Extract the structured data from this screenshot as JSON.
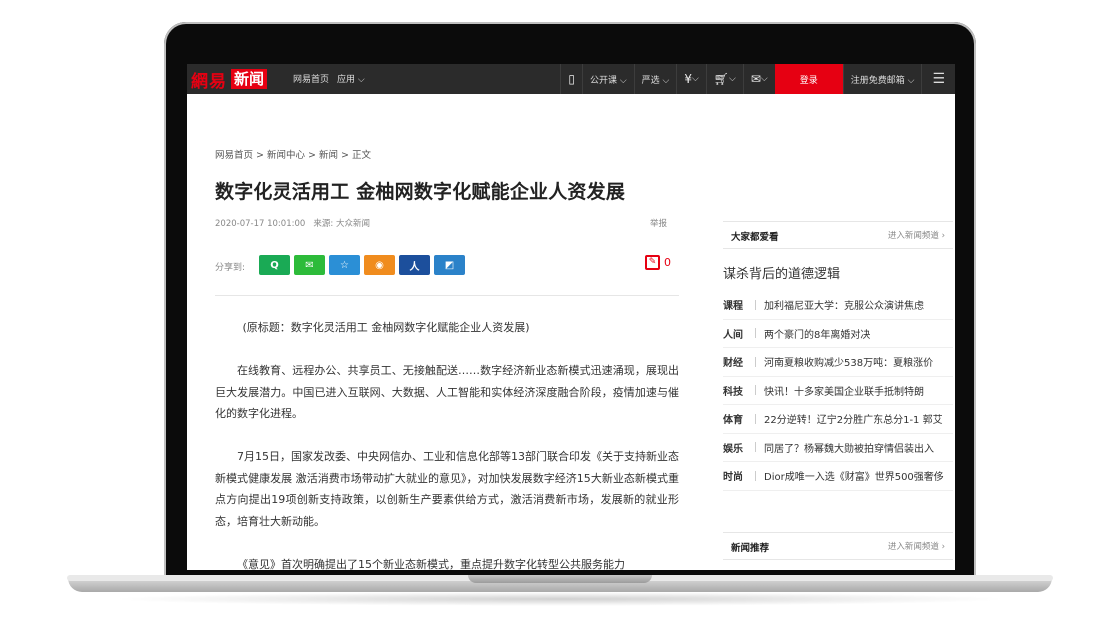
{
  "topnav": {
    "logo_163": "網易",
    "logo_news": "新闻",
    "left_links": [
      "网易首页",
      "应用 ⌵"
    ],
    "right_items": [
      {
        "label": "",
        "icon": "mobile-app-icon"
      },
      {
        "label": "公开课 ⌵",
        "icon": ""
      },
      {
        "label": "严选 ⌵",
        "icon": ""
      },
      {
        "label": "⌵",
        "icon": "yuan-icon"
      },
      {
        "label": "⌵",
        "icon": "cart-icon"
      },
      {
        "label": "⌵",
        "icon": "mail-icon"
      }
    ],
    "login": "登录",
    "register": "注册免费邮箱 ⌵",
    "menu": "☰"
  },
  "article": {
    "breadcrumb": "网易首页 > 新闻中心 > 新闻 > 正文",
    "title": "数字化灵活用工 金柚网数字化赋能企业人资发展",
    "time": "2020-07-17 10:01:00",
    "source": "来源: 大众新闻",
    "report": "举报",
    "share_label": "分享到:",
    "share_buttons": [
      {
        "name": "qq-icon",
        "glyph": "Q",
        "color": "#1aaa55"
      },
      {
        "name": "wechat-icon",
        "glyph": "✉",
        "color": "#2dbb3a"
      },
      {
        "name": "qzone-icon",
        "glyph": "☆",
        "color": "#2b8fd6"
      },
      {
        "name": "weibo-icon",
        "glyph": "◉",
        "color": "#f08c1e"
      },
      {
        "name": "renren-icon",
        "glyph": "人",
        "color": "#1c4f9c"
      },
      {
        "name": "yixin-icon",
        "glyph": "◩",
        "color": "#2b82c9"
      }
    ],
    "comment_count": "0",
    "paragraphs": [
      "(原标题：数字化灵活用工 金柚网数字化赋能企业人资发展)",
      "在线教育、远程办公、共享员工、无接触配送……数字经济新业态新模式迅速涌现，展现出巨大发展潜力。中国已进入互联网、大数据、人工智能和实体经济深度融合阶段，疫情加速与催化的数字化进程。",
      "7月15日，国家发改委、中央网信办、工业和信息化部等13部门联合印发《关于支持新业态新模式健康发展 激活消费市场带动扩大就业的意见》，对加快发展数字经济15大新业态新模式重点方向提出19项创新支持政策，以创新生产要素供给方式，激活消费新市场，发展新的就业形态，培育壮大新动能。",
      "《意见》首次明确提出了15个新业态新模式，重点提升数字化转型公共服务能力"
    ]
  },
  "sidebar": {
    "popular": {
      "heading": "大家都爱看",
      "more": "进入新闻频道 ›",
      "headline": "谋杀背后的道德逻辑",
      "items": [
        {
          "cat": "课程",
          "text": "加利福尼亚大学：克服公众演讲焦虑"
        },
        {
          "cat": "人间",
          "text": "两个豪门的8年离婚对决"
        },
        {
          "cat": "财经",
          "text": "河南夏粮收购减少538万吨：夏粮涨价"
        },
        {
          "cat": "科技",
          "text": "快讯！十多家美国企业联手抵制特朗"
        },
        {
          "cat": "体育",
          "text": "22分逆转！辽宁2分胜广东总分1-1 郭艾"
        },
        {
          "cat": "娱乐",
          "text": "同居了？杨幂魏大勋被拍穿情侣装出入"
        },
        {
          "cat": "时尚",
          "text": "Dior成唯一入选《财富》世界500强奢侈"
        }
      ]
    },
    "recommend": {
      "heading": "新闻推荐",
      "more": "进入新闻频道 ›"
    }
  }
}
